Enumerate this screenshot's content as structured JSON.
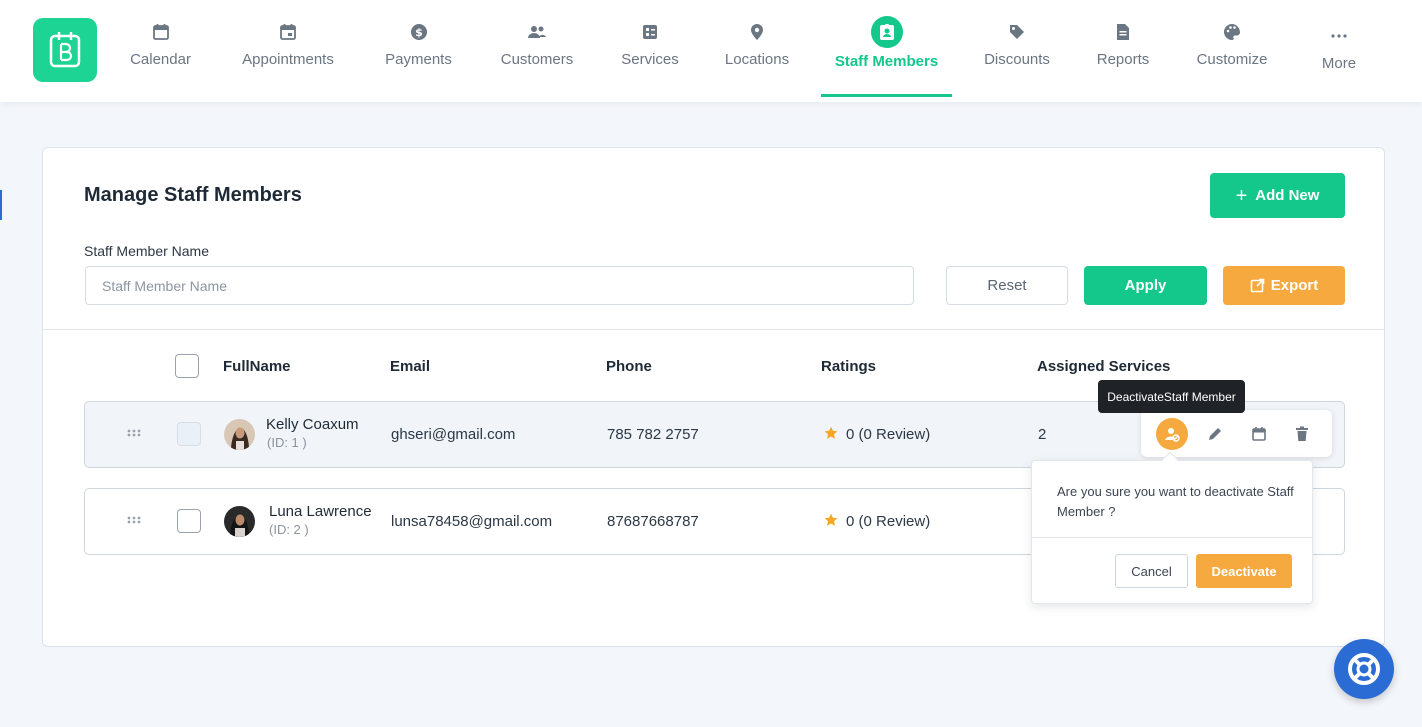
{
  "nav": {
    "items": [
      {
        "label": "Calendar",
        "icon": "calendar-icon"
      },
      {
        "label": "Appointments",
        "icon": "calendar-event-icon"
      },
      {
        "label": "Payments",
        "icon": "dollar-circle-icon"
      },
      {
        "label": "Customers",
        "icon": "users-icon"
      },
      {
        "label": "Services",
        "icon": "services-list-icon"
      },
      {
        "label": "Locations",
        "icon": "map-pin-icon"
      },
      {
        "label": "Staff Members",
        "icon": "staff-badge-icon",
        "active": true
      },
      {
        "label": "Discounts",
        "icon": "tag-icon"
      },
      {
        "label": "Reports",
        "icon": "report-file-icon"
      },
      {
        "label": "Customize",
        "icon": "palette-icon"
      },
      {
        "label": "More",
        "icon": "more-dots-icon"
      }
    ]
  },
  "page": {
    "title": "Manage Staff Members",
    "add_label": "Add New"
  },
  "filter": {
    "label": "Staff Member Name",
    "placeholder": "Staff Member Name",
    "reset_label": "Reset",
    "apply_label": "Apply",
    "export_label": "Export"
  },
  "table": {
    "headers": [
      "FullName",
      "Email",
      "Phone",
      "Ratings",
      "Assigned Services"
    ],
    "rows": [
      {
        "name": "Kelly Coaxum",
        "id": "(ID: 1 )",
        "email": "ghseri@gmail.com",
        "phone": "785 782 2757",
        "rating": "0 (0 Review)",
        "services": "2"
      },
      {
        "name": "Luna Lawrence",
        "id": "(ID: 2 )",
        "email": "lunsa78458@gmail.com",
        "phone": "87687668787",
        "rating": "0 (0 Review)",
        "services": ""
      }
    ]
  },
  "tooltip": {
    "text": "DeactivateStaff Member"
  },
  "popconfirm": {
    "message": "Are you sure you want to deactivate Staff Member ?",
    "cancel_label": "Cancel",
    "confirm_label": "Deactivate"
  },
  "colors": {
    "primary": "#14c88c",
    "warning": "#f5a93f",
    "help": "#2b6cd4"
  }
}
